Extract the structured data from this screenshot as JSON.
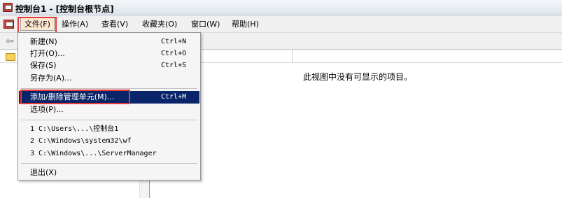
{
  "window": {
    "title": "控制台1 - [控制台根节点]"
  },
  "menubar": {
    "items": [
      {
        "label": "文件(F)"
      },
      {
        "label": "操作(A)"
      },
      {
        "label": "查看(V)"
      },
      {
        "label": "收藏夹(O)"
      },
      {
        "label": "窗口(W)"
      },
      {
        "label": "帮助(H)"
      }
    ]
  },
  "file_menu": {
    "items": [
      {
        "label": "新建(N)",
        "shortcut": "Ctrl+N"
      },
      {
        "label": "打开(O)...",
        "shortcut": "Ctrl+O"
      },
      {
        "label": "保存(S)",
        "shortcut": "Ctrl+S"
      },
      {
        "label": "另存为(A)..."
      },
      {
        "label": "添加/删除管理单元(M)...",
        "shortcut": "Ctrl+M"
      },
      {
        "label": "选项(P)..."
      },
      {
        "label": "1 C:\\Users\\...\\控制台1"
      },
      {
        "label": "2 C:\\Windows\\system32\\wf"
      },
      {
        "label": "3 C:\\Windows\\...\\ServerManager"
      },
      {
        "label": "退出(X)"
      }
    ]
  },
  "content": {
    "empty_message": "此视图中没有可显示的项目。"
  },
  "colors": {
    "selection": "#0a246a",
    "highlight_box": "#e53935"
  },
  "icons": {
    "app": "mmc-console-icon",
    "back": "back-arrow-icon",
    "folder": "folder-icon"
  }
}
